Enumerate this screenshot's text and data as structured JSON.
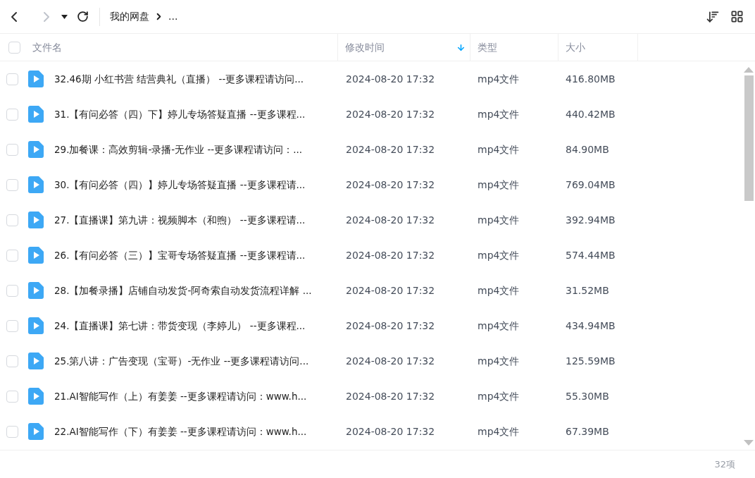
{
  "toolbar": {
    "back": {
      "disabled": false
    },
    "forward": {
      "disabled": true
    },
    "breadcrumb": [
      "我的网盘",
      "..."
    ]
  },
  "table": {
    "select_all": {
      "checked": false
    },
    "columns": [
      {
        "label": "文件名",
        "sorted": false
      },
      {
        "label": "修改时间",
        "sorted": true
      },
      {
        "label": "类型",
        "sorted": false
      },
      {
        "label": "大小",
        "sorted": false
      }
    ],
    "rows": [
      {
        "checked": false,
        "name": "32.46期 小红书营 结营典礼（直播） --更多课程请访问...",
        "modified": "2024-08-20 17:32",
        "type": "mp4文件",
        "size": "416.80MB"
      },
      {
        "checked": false,
        "name": "31.【有问必答（四）下】婷儿专场答疑直播 --更多课程...",
        "modified": "2024-08-20 17:32",
        "type": "mp4文件",
        "size": "440.42MB"
      },
      {
        "checked": false,
        "name": "29.加餐课：高效剪辑-录播-无作业 --更多课程请访问：...",
        "modified": "2024-08-20 17:32",
        "type": "mp4文件",
        "size": "84.90MB"
      },
      {
        "checked": false,
        "name": "30.【有问必答（四）】婷儿专场答疑直播 --更多课程请...",
        "modified": "2024-08-20 17:32",
        "type": "mp4文件",
        "size": "769.04MB"
      },
      {
        "checked": false,
        "name": "27.【直播课】第九讲：视频脚本（和煦） --更多课程请...",
        "modified": "2024-08-20 17:32",
        "type": "mp4文件",
        "size": "392.94MB"
      },
      {
        "checked": false,
        "name": "26.【有问必答（三）】宝哥专场答疑直播 --更多课程请...",
        "modified": "2024-08-20 17:32",
        "type": "mp4文件",
        "size": "574.44MB"
      },
      {
        "checked": false,
        "name": "28.【加餐录播】店铺自动发货-阿奇索自动发货流程详解 ...",
        "modified": "2024-08-20 17:32",
        "type": "mp4文件",
        "size": "31.52MB"
      },
      {
        "checked": false,
        "name": "24.【直播课】第七讲：带货变现（李婷儿） --更多课程...",
        "modified": "2024-08-20 17:32",
        "type": "mp4文件",
        "size": "434.94MB"
      },
      {
        "checked": false,
        "name": "25.第八讲：广告变现（宝哥）-无作业 --更多课程请访问...",
        "modified": "2024-08-20 17:32",
        "type": "mp4文件",
        "size": "125.59MB"
      },
      {
        "checked": false,
        "name": "21.AI智能写作（上）有姜姜 --更多课程请访问：www.h...",
        "modified": "2024-08-20 17:32",
        "type": "mp4文件",
        "size": "55.30MB"
      },
      {
        "checked": false,
        "name": "22.AI智能写作（下）有姜姜 --更多课程请访问：www.h...",
        "modified": "2024-08-20 17:32",
        "type": "mp4文件",
        "size": "67.39MB"
      }
    ]
  },
  "status_bar": {
    "count": "32项"
  }
}
